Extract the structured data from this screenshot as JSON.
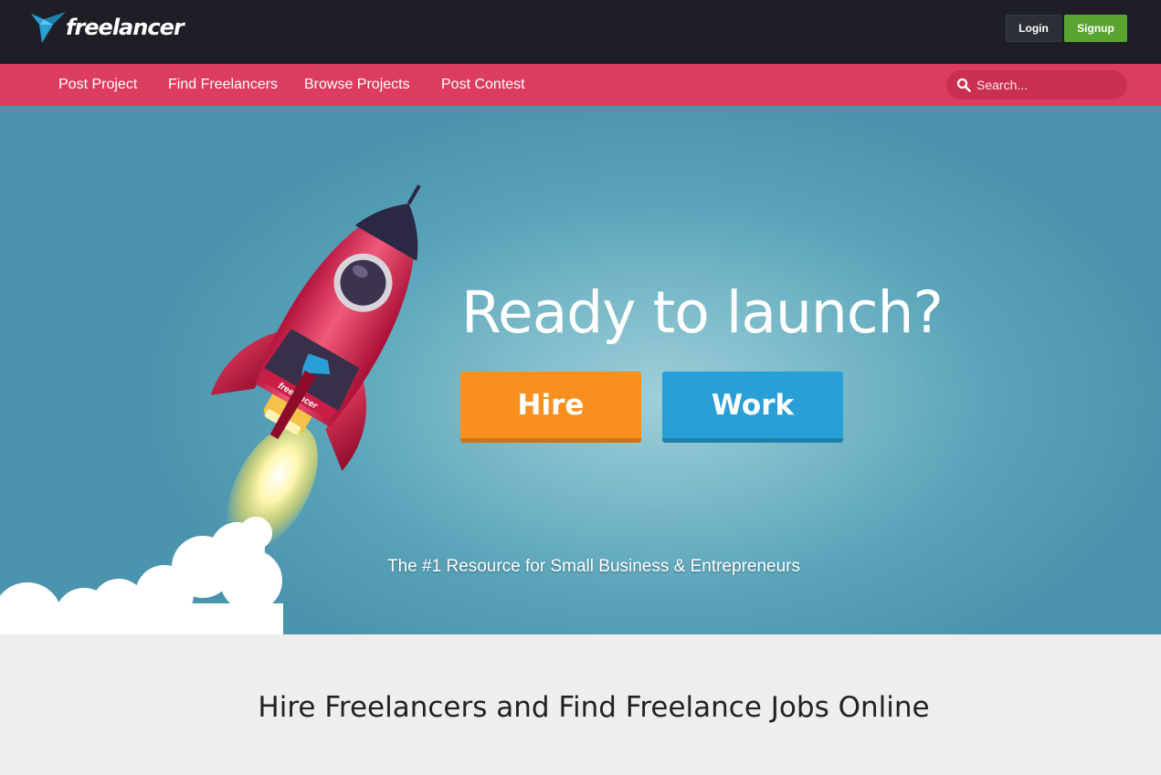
{
  "brand": {
    "name": "freelancer",
    "logo_color": "#2a9fd6"
  },
  "auth": {
    "login_label": "Login",
    "signup_label": "Signup"
  },
  "nav": {
    "items": [
      {
        "label": "Post Project"
      },
      {
        "label": "Find Freelancers"
      },
      {
        "label": "Browse Projects"
      },
      {
        "label": "Post Contest"
      }
    ],
    "search": {
      "placeholder": "Search...",
      "icon": "search-icon"
    }
  },
  "hero": {
    "headline": "Ready to launch?",
    "hire_label": "Hire",
    "work_label": "Work",
    "tagline": "The #1 Resource for Small Business & Entrepreneurs",
    "rocket_label": "freelancer",
    "colors": {
      "hire": "#f7901e",
      "work": "#2a9fd6",
      "nav": "#dc3d5f",
      "signup": "#5aa531"
    }
  },
  "section": {
    "title": "Hire Freelancers and Find Freelance Jobs Online"
  }
}
